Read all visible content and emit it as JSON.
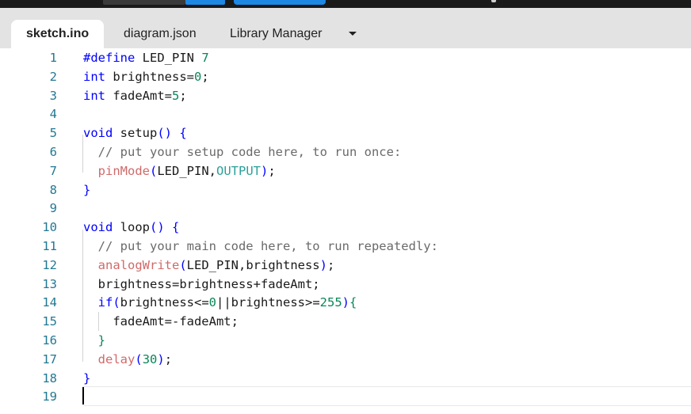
{
  "tabs": [
    {
      "label": "sketch.ino"
    },
    {
      "label": "diagram.json"
    },
    {
      "label": "Library Manager"
    }
  ],
  "editor": {
    "lines": [
      {
        "num": "1",
        "tokens": [
          [
            "k",
            "#define"
          ],
          [
            "p",
            " LED_PIN "
          ],
          [
            "n",
            "7"
          ]
        ]
      },
      {
        "num": "2",
        "tokens": [
          [
            "k",
            "int"
          ],
          [
            "p",
            " brightness="
          ],
          [
            "n",
            "0"
          ],
          [
            "p",
            ";"
          ]
        ]
      },
      {
        "num": "3",
        "tokens": [
          [
            "k",
            "int"
          ],
          [
            "p",
            " fadeAmt="
          ],
          [
            "n",
            "5"
          ],
          [
            "p",
            ";"
          ]
        ]
      },
      {
        "num": "4",
        "tokens": []
      },
      {
        "num": "5",
        "tokens": [
          [
            "k",
            "void"
          ],
          [
            "p",
            " setup"
          ],
          [
            "k",
            "()"
          ],
          [
            "p",
            " "
          ],
          [
            "k",
            "{"
          ]
        ]
      },
      {
        "num": "6",
        "tokens": [
          [
            "p",
            "  "
          ],
          [
            "c",
            "// put your setup code here, to run once:"
          ]
        ]
      },
      {
        "num": "7",
        "tokens": [
          [
            "p",
            "  "
          ],
          [
            "f",
            "pinMode"
          ],
          [
            "k",
            "("
          ],
          [
            "p",
            "LED_PIN,"
          ],
          [
            "t",
            "OUTPUT"
          ],
          [
            "k",
            ")"
          ],
          [
            "p",
            ";"
          ]
        ]
      },
      {
        "num": "8",
        "tokens": [
          [
            "k",
            "}"
          ]
        ]
      },
      {
        "num": "9",
        "tokens": []
      },
      {
        "num": "10",
        "tokens": [
          [
            "k",
            "void"
          ],
          [
            "p",
            " loop"
          ],
          [
            "k",
            "()"
          ],
          [
            "p",
            " "
          ],
          [
            "k",
            "{"
          ]
        ]
      },
      {
        "num": "11",
        "tokens": [
          [
            "p",
            "  "
          ],
          [
            "c",
            "// put your main code here, to run repeatedly:"
          ]
        ]
      },
      {
        "num": "12",
        "tokens": [
          [
            "p",
            "  "
          ],
          [
            "f",
            "analogWrite"
          ],
          [
            "k",
            "("
          ],
          [
            "p",
            "LED_PIN,brightness"
          ],
          [
            "k",
            ")"
          ],
          [
            "p",
            ";"
          ]
        ]
      },
      {
        "num": "13",
        "tokens": [
          [
            "p",
            "  brightness=brightness+fadeAmt;"
          ]
        ]
      },
      {
        "num": "14",
        "tokens": [
          [
            "p",
            "  "
          ],
          [
            "k",
            "if("
          ],
          [
            "p",
            "brightness<="
          ],
          [
            "n",
            "0"
          ],
          [
            "p",
            "||brightness>="
          ],
          [
            "n",
            "255"
          ],
          [
            "k",
            ")"
          ],
          [
            "n",
            "{"
          ]
        ]
      },
      {
        "num": "15",
        "tokens": [
          [
            "p",
            "    fadeAmt=-fadeAmt;"
          ]
        ]
      },
      {
        "num": "16",
        "tokens": [
          [
            "p",
            "  "
          ],
          [
            "n",
            "}"
          ]
        ]
      },
      {
        "num": "17",
        "tokens": [
          [
            "p",
            "  "
          ],
          [
            "f",
            "delay"
          ],
          [
            "k",
            "("
          ],
          [
            "n",
            "30"
          ],
          [
            "k",
            ")"
          ],
          [
            "p",
            ";"
          ]
        ]
      },
      {
        "num": "18",
        "tokens": [
          [
            "k",
            "}"
          ]
        ]
      },
      {
        "num": "19",
        "tokens": []
      }
    ]
  }
}
